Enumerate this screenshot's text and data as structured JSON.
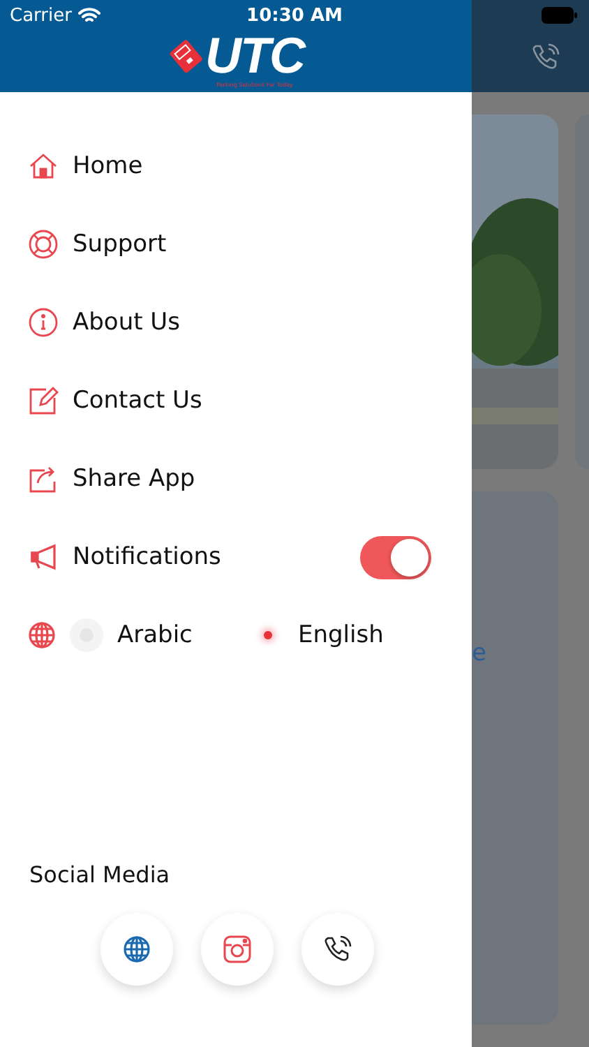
{
  "status_bar": {
    "carrier": "Carrier",
    "time": "10:30 AM"
  },
  "logo": {
    "text": "UTC",
    "tagline": "Parking Solutions For Today"
  },
  "menu": [
    {
      "label": "Home",
      "kind": "home"
    },
    {
      "label": "Support",
      "kind": "support"
    },
    {
      "label": "About Us",
      "kind": "about"
    },
    {
      "label": "Contact Us",
      "kind": "contact"
    },
    {
      "label": "Share App",
      "kind": "share"
    }
  ],
  "notifications": {
    "label": "Notifications",
    "on": true
  },
  "languages": [
    {
      "label": "Arabic",
      "selected": false
    },
    {
      "label": "English",
      "selected": true
    }
  ],
  "social": {
    "title": "Social Media",
    "buttons": [
      {
        "kind": "web"
      },
      {
        "kind": "instagram"
      },
      {
        "kind": "phone"
      }
    ]
  },
  "background": {
    "text_fragment": "e"
  }
}
